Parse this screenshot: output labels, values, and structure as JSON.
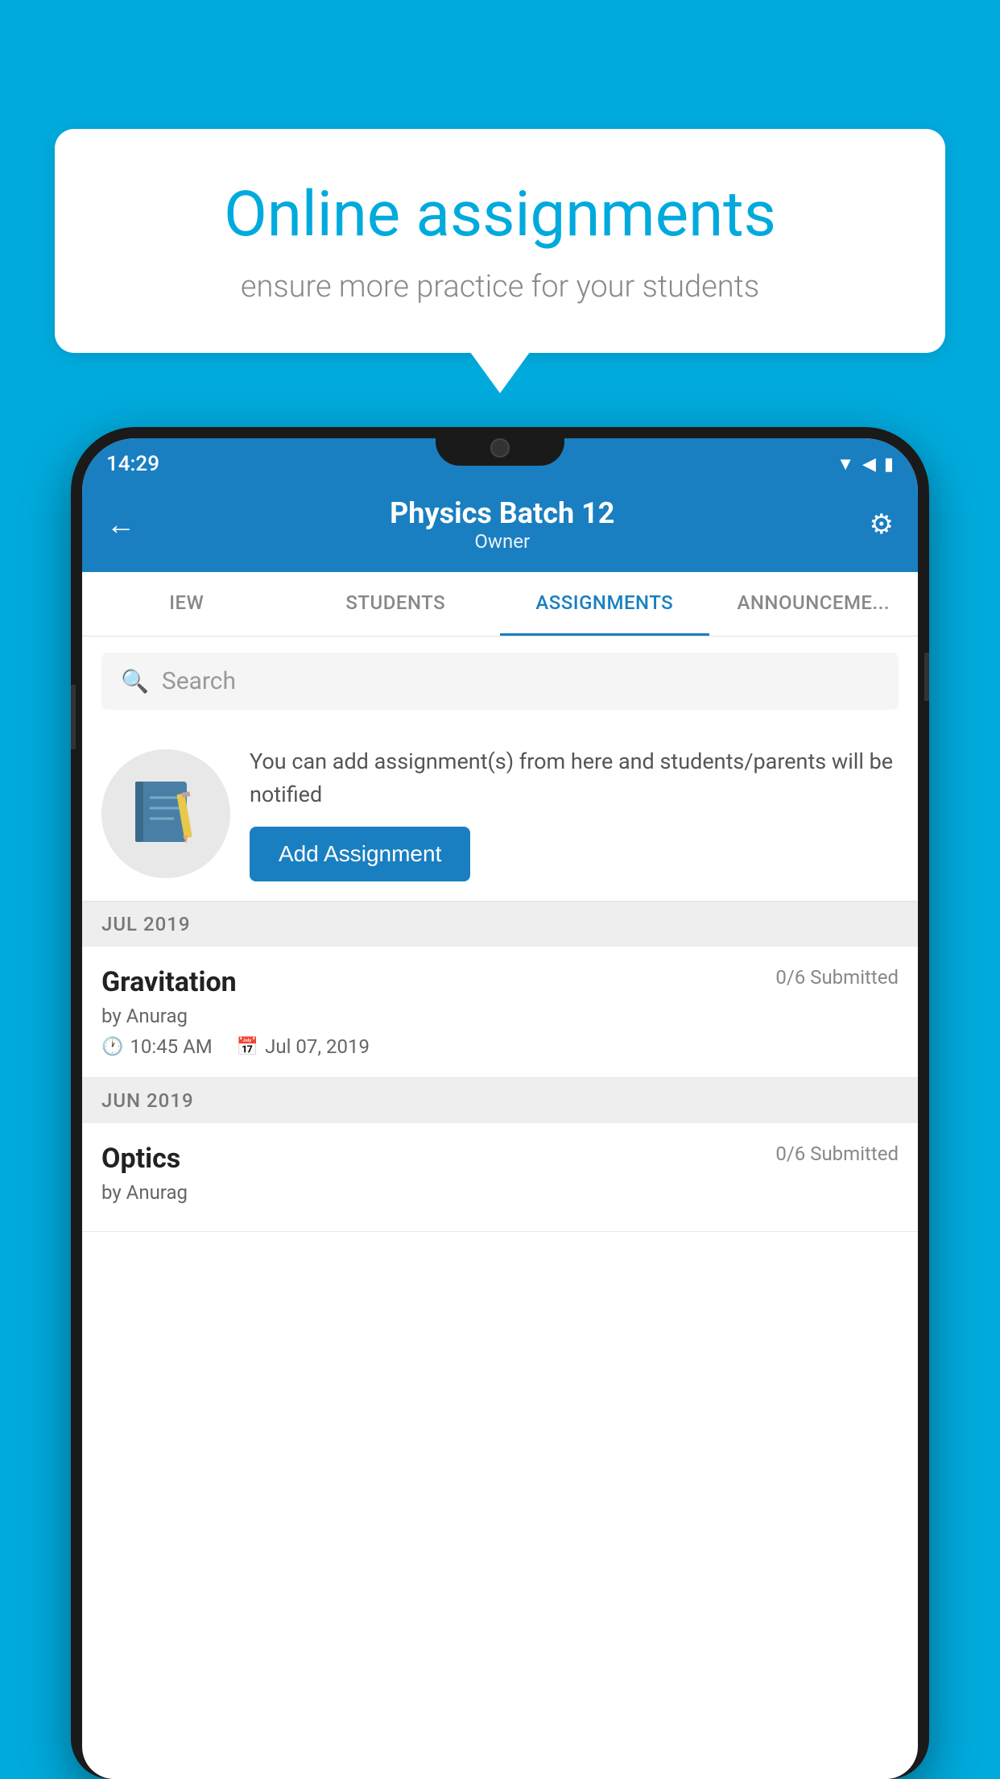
{
  "background_color": "#00AADD",
  "bubble": {
    "title": "Online assignments",
    "subtitle": "ensure more practice for your students"
  },
  "status_bar": {
    "time": "14:29",
    "icons": "▼◀▮"
  },
  "header": {
    "title": "Physics Batch 12",
    "subtitle": "Owner",
    "back_label": "←",
    "settings_label": "⚙"
  },
  "tabs": [
    {
      "label": "IEW",
      "active": false
    },
    {
      "label": "STUDENTS",
      "active": false
    },
    {
      "label": "ASSIGNMENTS",
      "active": true
    },
    {
      "label": "ANNOUNCEMENTS",
      "active": false
    }
  ],
  "search": {
    "placeholder": "Search"
  },
  "promo": {
    "text": "You can add assignment(s) from here and students/parents will be notified",
    "button_label": "Add Assignment"
  },
  "sections": [
    {
      "month": "JUL 2019",
      "assignments": [
        {
          "name": "Gravitation",
          "submitted": "0/6 Submitted",
          "by": "by Anurag",
          "time": "10:45 AM",
          "date": "Jul 07, 2019"
        }
      ]
    },
    {
      "month": "JUN 2019",
      "assignments": [
        {
          "name": "Optics",
          "submitted": "0/6 Submitted",
          "by": "by Anurag",
          "time": "",
          "date": ""
        }
      ]
    }
  ]
}
